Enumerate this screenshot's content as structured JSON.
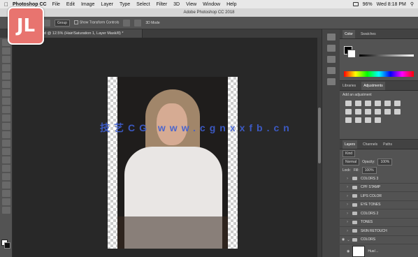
{
  "menubar": {
    "app_name": "Photoshop CC",
    "items": [
      "File",
      "Edit",
      "Image",
      "Layer",
      "Type",
      "Select",
      "Filter",
      "3D",
      "View",
      "Window",
      "Help"
    ],
    "battery": "96%",
    "clock": "Wed 8:18 PM"
  },
  "window": {
    "title": "Adobe Photoshop CC 2018"
  },
  "options_bar": {
    "group_label": "Group",
    "show_transform": "Show Transform Controls",
    "mode_3d": "3D Mode"
  },
  "document_tab": {
    "label": "ed @ 12.5% (Hair/Saturation 1, Layer Mask/8) *"
  },
  "panels": {
    "color_tabs": [
      "Color",
      "Swatches"
    ],
    "library_tabs": [
      "Libraries",
      "Adjustments"
    ],
    "add_adjustment": "Add an adjustment",
    "layers_tabs": [
      "Layers",
      "Channels",
      "Paths"
    ],
    "kind_label": "Kind",
    "blend_mode": "Normal",
    "opacity_label": "Opacity:",
    "opacity_value": "100%",
    "lock_label": "Lock:",
    "fill_label": "Fill:",
    "fill_value": "100%",
    "thumb_label": "Hue/..."
  },
  "layers": [
    {
      "name": "COLORS 3"
    },
    {
      "name": "CPF STAMP"
    },
    {
      "name": "LIPS COLOR"
    },
    {
      "name": "EYE TONES"
    },
    {
      "name": "COLORS 2"
    },
    {
      "name": "TONES"
    },
    {
      "name": "SKIN RETOUCH"
    },
    {
      "name": "COLORS"
    }
  ],
  "overlay": {
    "logo_glyph": "JL",
    "watermark": "技艺CG www.cgnxxfb.cn"
  },
  "colors": {
    "accent_logo": "#e8746f",
    "watermark": "#3f5fd3"
  }
}
